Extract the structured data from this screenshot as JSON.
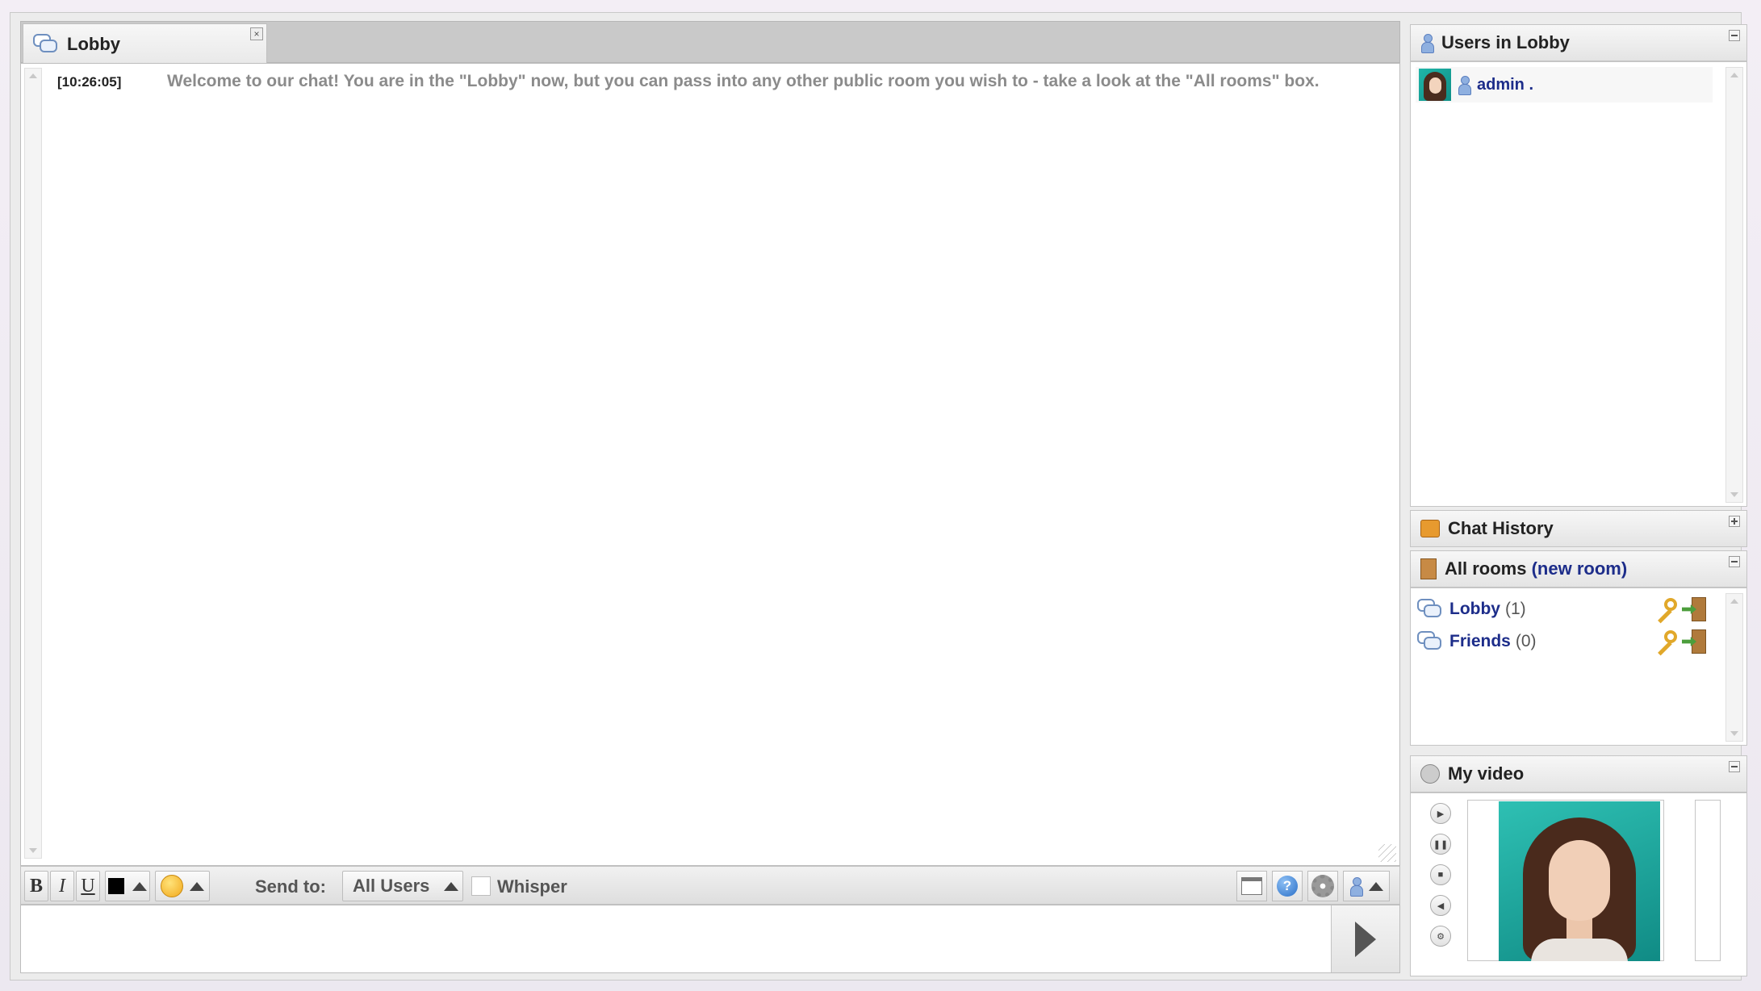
{
  "chat_tab": {
    "label": "Lobby",
    "close_label": "×"
  },
  "messages": [
    {
      "time": "[10:26:05]",
      "text": "Welcome to our chat! You are in the \"Lobby\" now, but you can pass into any other public room you wish to - take a look at the \"All rooms\" box."
    }
  ],
  "toolbar": {
    "bold_label": "B",
    "italic_label": "I",
    "underline_label": "U",
    "text_color": "#000000",
    "send_to_label": "Send to:",
    "send_to_value": "All Users",
    "whisper_label": "Whisper",
    "help_glyph": "?"
  },
  "input": {
    "placeholder": ""
  },
  "sidebar": {
    "users_panel": {
      "title": "Users in Lobby",
      "users": [
        {
          "name": "admin ."
        }
      ]
    },
    "history_panel": {
      "title": "Chat History"
    },
    "rooms_panel": {
      "title": "All rooms",
      "paren_open": "(",
      "new_room_link": "new room",
      "paren_close": ")",
      "rooms": [
        {
          "name": "Lobby",
          "count": "(1)"
        },
        {
          "name": "Friends",
          "count": "(0)"
        }
      ]
    },
    "video_panel": {
      "title": "My video",
      "controls": [
        "play-icon",
        "pause-icon",
        "stop-icon",
        "volume-icon",
        "settings-icon"
      ]
    }
  },
  "colors": {
    "link": "#1d2d8a",
    "message_text": "#8b8b8b",
    "avatar_bg": "#1fb5a8"
  }
}
